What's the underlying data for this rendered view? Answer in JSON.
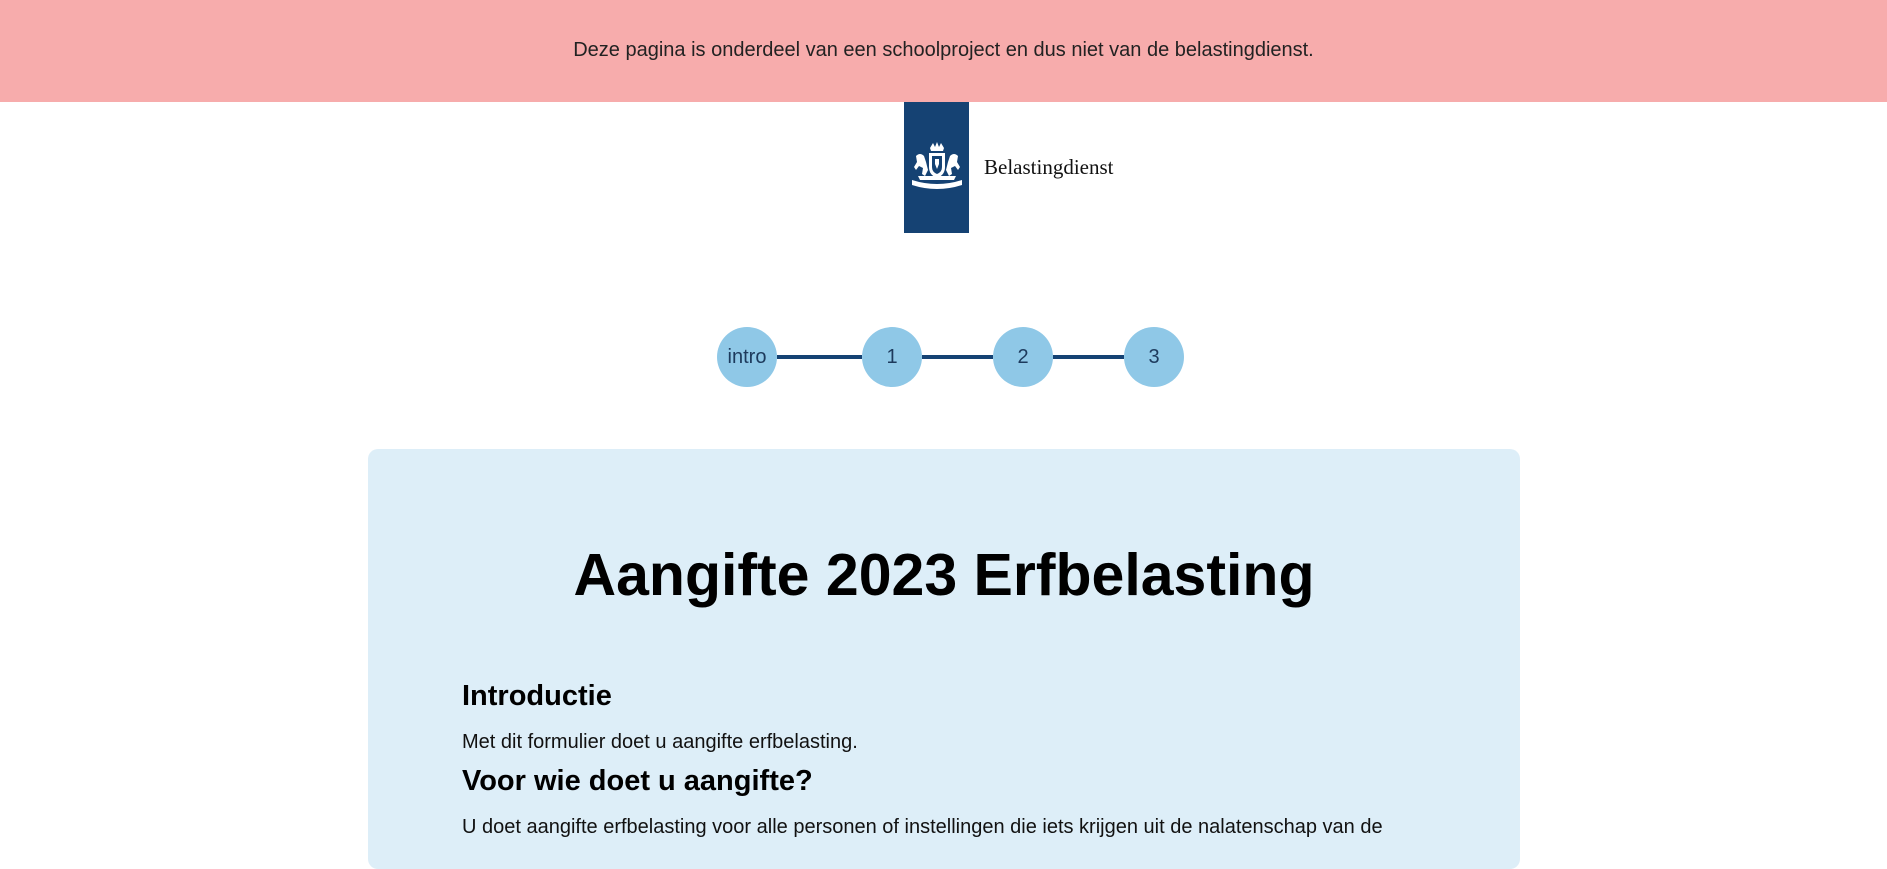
{
  "banner": {
    "text": "Deze pagina is onderdeel van een schoolproject en dus niet van de belastingdienst."
  },
  "logo": {
    "name": "Belastingdienst",
    "emblem_icon": "royal-coat-of-arms-icon",
    "block_color": "#154273"
  },
  "stepper": {
    "steps": [
      {
        "label": "intro"
      },
      {
        "label": "1"
      },
      {
        "label": "2"
      },
      {
        "label": "3"
      }
    ],
    "circle_color": "#8fc8e7",
    "line_color": "#154273"
  },
  "content": {
    "title": "Aangifte 2023 Erfbelasting",
    "sections": [
      {
        "heading": "Introductie",
        "body": "Met dit formulier doet u aangifte erfbelasting."
      },
      {
        "heading": "Voor wie doet u aangifte?",
        "body": "U doet aangifte erfbelasting voor alle personen of instellingen die iets krijgen uit de nalatenschap van de"
      }
    ]
  },
  "colors": {
    "banner_bg": "#f7acac",
    "card_bg": "#ddeef8"
  }
}
